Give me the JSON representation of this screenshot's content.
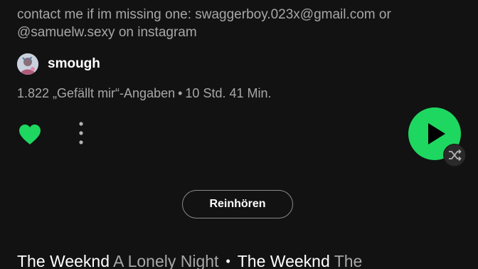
{
  "playlist": {
    "description": "contact me if im missing one: swaggerboy.023x@gmail.com or @samuelw.sexy on instagram",
    "owner": "smough",
    "likes": "1.822 „Gefällt mir“-Angaben",
    "meta_separator": "•",
    "duration": "10 Std. 41 Min."
  },
  "actions": {
    "like_icon": "heart-filled-icon",
    "more_icon": "more-vertical-icon",
    "play_icon": "play-icon",
    "shuffle_icon": "shuffle-icon",
    "preview_label": "Reinhören"
  },
  "preview_tracks": [
    {
      "artist": "The Weeknd",
      "title": "A Lonely Night"
    },
    {
      "artist": "The Weeknd",
      "title": "The"
    }
  ],
  "preview_separator": "•",
  "colors": {
    "background": "#121212",
    "accent_green": "#1ed760",
    "text_primary": "#ffffff",
    "text_secondary": "#a7a7a7"
  }
}
